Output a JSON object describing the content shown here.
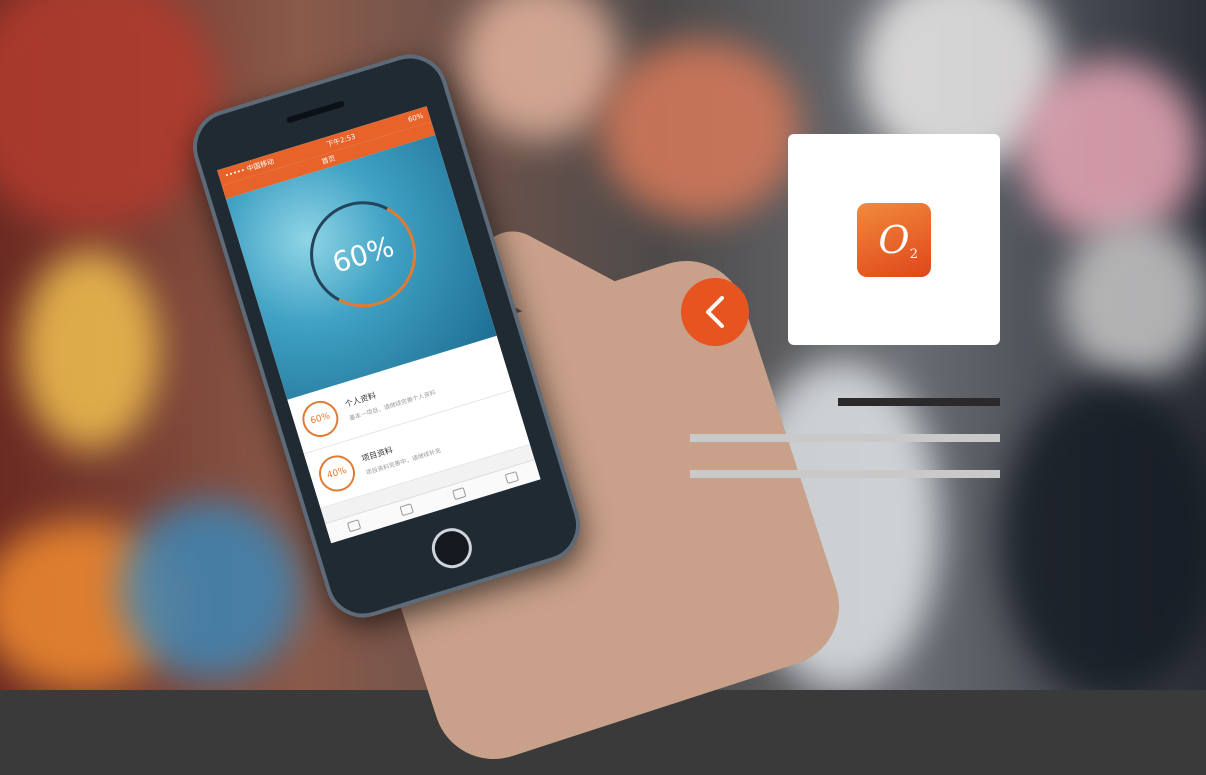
{
  "phone": {
    "status_left": "••••• 中国移动",
    "status_time": "下午2:53",
    "status_right": "60%",
    "nav_title": "首页",
    "progress_label": "60%",
    "list": [
      {
        "percent": "60%",
        "title": "个人资料",
        "sub": "基本一项目，请继续完善个人资料"
      },
      {
        "percent": "40%",
        "title": "项目资料",
        "sub": "项目资料完善中，请继续补充"
      }
    ]
  },
  "app_icon": {
    "letter": "O",
    "subscript": "2"
  },
  "colors": {
    "accent": "#e7541f",
    "card": "#ffffff"
  }
}
